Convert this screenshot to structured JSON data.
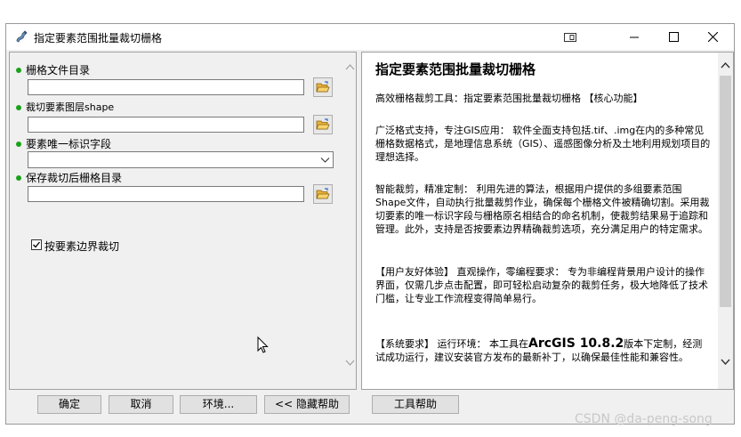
{
  "window": {
    "title": "指定要素范围批量裁切栅格",
    "icon": "arcgis-tool-icon"
  },
  "form": {
    "raster_dir_label": "栅格文件目录",
    "raster_dir_value": "",
    "clip_layer_label": "裁切要素图层shape",
    "clip_layer_value": "",
    "unique_field_label": "要素唯一标识字段",
    "unique_field_value": "",
    "output_dir_label": "保存裁切后栅格目录",
    "output_dir_value": "",
    "clip_boundary_label": "按要素边界裁切",
    "clip_boundary_checked": true,
    "required_dot_color": "#1aa21a"
  },
  "help": {
    "title": "指定要素范围批量裁切栅格",
    "p1": "高效栅格裁剪工具：指定要素范围批量裁切栅格 【核心功能】",
    "p2": "广泛格式支持，专注GIS应用： 软件全面支持包括.tif、.img在内的多种常见栅格数据格式，是地理信息系统（GIS）、遥感图像分析及土地利用规划项目的理想选择。",
    "p3": "智能裁剪，精准定制： 利用先进的算法，根据用户提供的多组要素范围Shape文件，自动执行批量裁剪作业，确保每个栅格文件被精确切割。采用裁切要素的唯一标识字段与栅格原名相结合的命名机制，使裁剪结果易于追踪和管理。此外，支持是否按要素边界精确裁剪选项，充分满足用户的特定需求。",
    "p4": "【用户友好体验】 直观操作，零编程要求： 专为非编程背景用户设计的操作界面，仅需几步点击配置，即可轻松启动复杂的裁剪任务，极大地降低了技术门槛，让专业工作流程变得简单易行。",
    "p5_pre": "【系统要求】 运行环境： 本工具在",
    "p5_big": "ArcGIS 10.8.2",
    "p5_post": "版本下定制，经测试成功运行，建议安装官方发布的最新补丁，以确保最佳性能和兼容性。"
  },
  "buttons": {
    "ok": "确定",
    "cancel": "取消",
    "env": "环境...",
    "hide_help": "<< 隐藏帮助",
    "tool_help": "工具帮助"
  },
  "watermark": "CSDN @da-peng-song"
}
